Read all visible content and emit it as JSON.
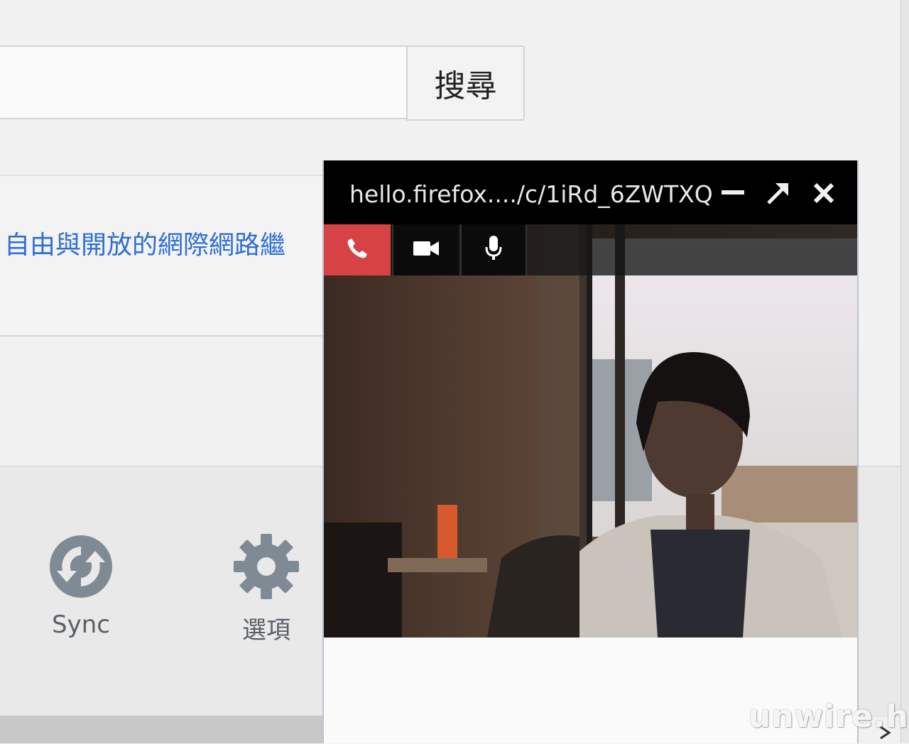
{
  "search": {
    "input_value": "",
    "button_label": "搜尋"
  },
  "snippet": {
    "link_text": "自由與開放的網際網路繼"
  },
  "launcher": {
    "sync_label": "Sync",
    "options_label": "選項",
    "icons": [
      "sync-icon",
      "gear-icon"
    ]
  },
  "hello": {
    "title": "hello.firefox..../c/1iRd_6ZWTXQ",
    "window_icons": [
      "minimize-icon",
      "expand-icon",
      "close-icon"
    ],
    "controls": [
      "phone-icon",
      "video-camera-icon",
      "microphone-icon"
    ],
    "hangup_color": "#d74345"
  },
  "watermark": "unwire.hk"
}
